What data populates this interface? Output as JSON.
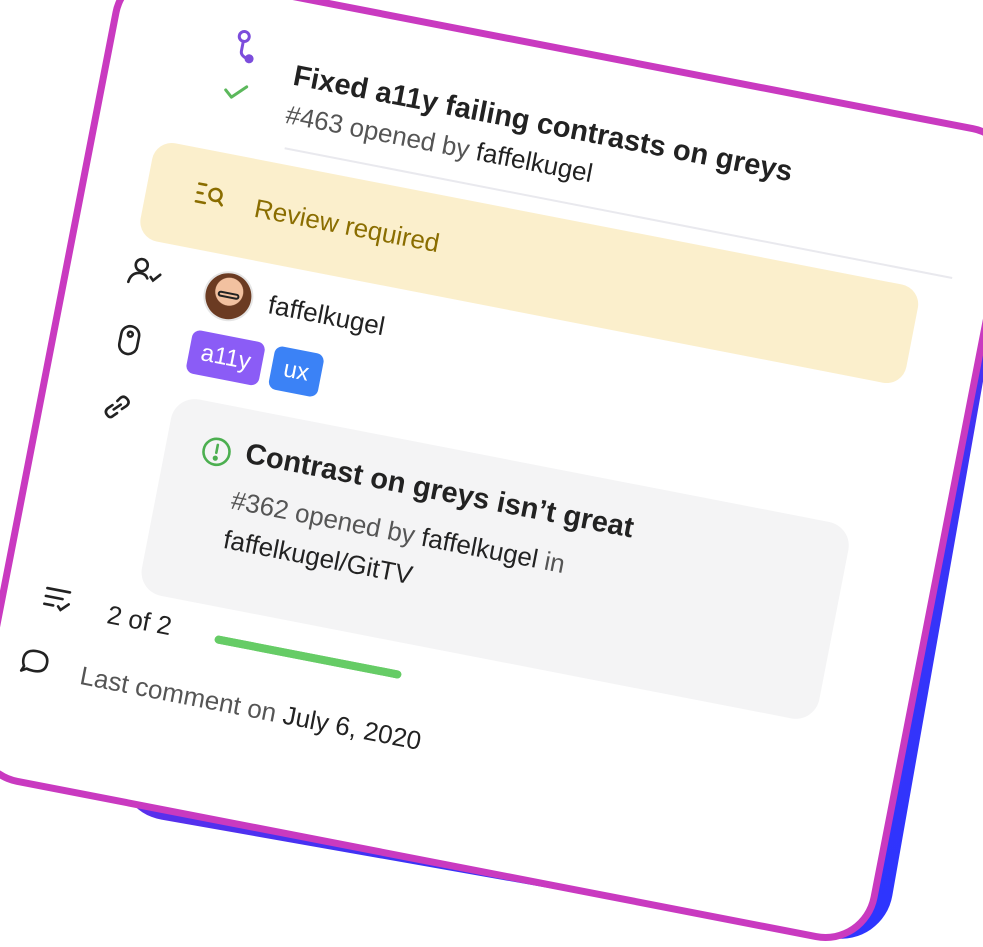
{
  "pull_request": {
    "title": "Fixed a11y failing contrasts on greys",
    "number": "#463",
    "opened_by_text": "opened by",
    "author": "faffelkugel"
  },
  "review": {
    "label": "Review required",
    "color": "#8a6d00",
    "background": "#fbefcc"
  },
  "assignee": {
    "name": "faffelkugel"
  },
  "labels": [
    {
      "name": "a11y",
      "color": "#8b5cf6"
    },
    {
      "name": "ux",
      "color": "#3b82f6"
    }
  ],
  "linked_issue": {
    "title": "Contrast on greys isn’t great",
    "number": "#362",
    "opened_by_text": "opened by",
    "author": "faffelkugel",
    "in_text": "in",
    "repo": "faffelkugel/GitTV"
  },
  "checks": {
    "text": "2 of 2",
    "progress": 1.0,
    "color": "#66cc66"
  },
  "comment": {
    "prefix": "Last comment on",
    "date": "July 6, 2020"
  },
  "icons": {
    "pr": "git-pull-request-icon",
    "status": "check-icon",
    "review": "review-search-icon",
    "assignee": "person-check-icon",
    "label": "tag-icon",
    "link": "link-icon",
    "issue": "issue-opened-icon",
    "checklist": "checklist-icon",
    "comment": "comment-icon"
  }
}
